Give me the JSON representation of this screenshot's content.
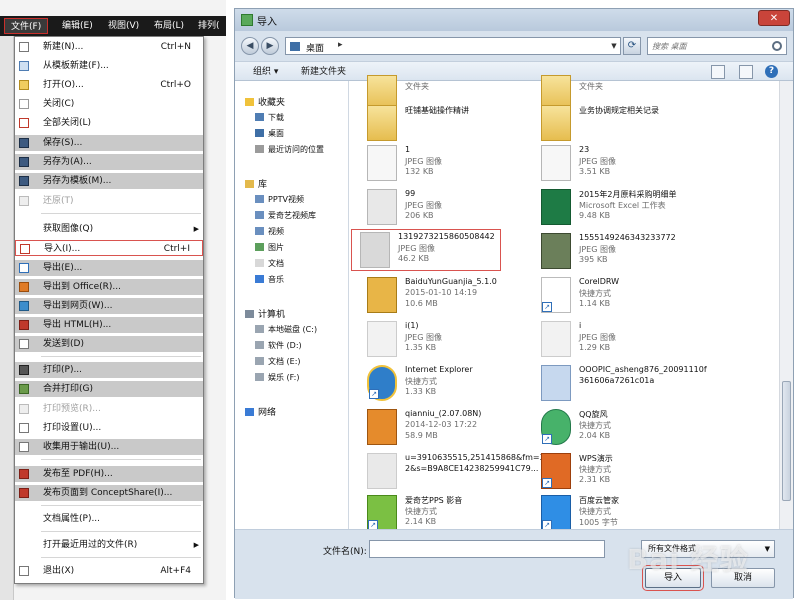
{
  "menubar": {
    "items": [
      {
        "label": "文件(F)"
      },
      {
        "label": "编辑(E)"
      },
      {
        "label": "视图(V)"
      },
      {
        "label": "布局(L)"
      },
      {
        "label": "排列("
      }
    ]
  },
  "file_menu": {
    "items": [
      {
        "label": "新建(N)...",
        "shortcut": "Ctrl+N",
        "shaded": false,
        "disabled": false
      },
      {
        "label": "从模板新建(F)...",
        "shortcut": "",
        "shaded": false,
        "disabled": false
      },
      {
        "label": "打开(O)...",
        "shortcut": "Ctrl+O",
        "shaded": false,
        "disabled": false
      },
      {
        "label": "关闭(C)",
        "shortcut": "",
        "shaded": false,
        "disabled": false
      },
      {
        "label": "全部关闭(L)",
        "shortcut": "",
        "shaded": false,
        "disabled": false
      },
      {
        "label": "保存(S)...",
        "shortcut": "",
        "shaded": true,
        "disabled": false
      },
      {
        "label": "另存为(A)...",
        "shortcut": "",
        "shaded": true,
        "disabled": false
      },
      {
        "label": "另存为模板(M)...",
        "shortcut": "",
        "shaded": true,
        "disabled": false
      },
      {
        "label": "还原(T)",
        "shortcut": "",
        "shaded": false,
        "disabled": true
      },
      {
        "label": "获取图像(Q)",
        "shortcut": "",
        "shaded": false,
        "disabled": false,
        "submenu": true
      },
      {
        "label": "导入(I)...",
        "shortcut": "Ctrl+I",
        "shaded": false,
        "disabled": false,
        "highlight": true
      },
      {
        "label": "导出(E)...",
        "shortcut": "",
        "shaded": true,
        "disabled": false
      },
      {
        "label": "导出到 Office(R)...",
        "shortcut": "",
        "shaded": true,
        "disabled": false
      },
      {
        "label": "导出到网页(W)...",
        "shortcut": "",
        "shaded": true,
        "disabled": false
      },
      {
        "label": "导出 HTML(H)...",
        "shortcut": "",
        "shaded": true,
        "disabled": false
      },
      {
        "label": "发送到(D)",
        "shortcut": "",
        "shaded": true,
        "disabled": false
      },
      {
        "label": "打印(P)...",
        "shortcut": "",
        "shaded": true,
        "disabled": false
      },
      {
        "label": "合并打印(G)",
        "shortcut": "",
        "shaded": true,
        "disabled": false
      },
      {
        "label": "打印预览(R)...",
        "shortcut": "",
        "shaded": false,
        "disabled": true
      },
      {
        "label": "打印设置(U)...",
        "shortcut": "",
        "shaded": false,
        "disabled": false
      },
      {
        "label": "收集用于输出(U)...",
        "shortcut": "",
        "shaded": true,
        "disabled": false
      },
      {
        "label": "发布至 PDF(H)...",
        "shortcut": "",
        "shaded": true,
        "disabled": false
      },
      {
        "label": "发布页面到 ConceptShare(I)...",
        "shortcut": "",
        "shaded": true,
        "disabled": false
      },
      {
        "label": "文档属性(P)...",
        "shortcut": "",
        "shaded": false,
        "disabled": false
      },
      {
        "label": "打开最近用过的文件(R)",
        "shortcut": "",
        "shaded": false,
        "disabled": false,
        "submenu": true
      },
      {
        "label": "退出(X)",
        "shortcut": "Alt+F4",
        "shaded": false,
        "disabled": false
      }
    ]
  },
  "dialog": {
    "title": "导入",
    "close_label": "✕",
    "address": {
      "location": "桌面",
      "separator": "▸"
    },
    "search_placeholder": "搜索 桌面",
    "toolbar": {
      "organize": "组织 ▾",
      "new_folder": "新建文件夹"
    },
    "nav": {
      "favorites_label": "收藏夹",
      "favorites": [
        "下载",
        "桌面",
        "最近访问的位置"
      ],
      "libraries_label": "库",
      "libraries": [
        "PPTV视频",
        "爱奇艺视频库",
        "视频",
        "图片",
        "文档",
        "音乐"
      ],
      "computer_label": "计算机",
      "drives": [
        "本地磁盘 (C:)",
        "软件 (D:)",
        "文档 (E:)",
        "娱乐 (F:)"
      ],
      "network_label": "网络"
    },
    "files": [
      {
        "name": "",
        "kind": "文件夹",
        "meta": "",
        "icon": "folder"
      },
      {
        "name": "",
        "kind": "文件夹",
        "meta": "",
        "icon": "folder"
      },
      {
        "name": "旺铺基础操作精讲",
        "kind": "",
        "meta": "",
        "icon": "folder"
      },
      {
        "name": "业务协调规定相关记录",
        "kind": "",
        "meta": "",
        "icon": "folder"
      },
      {
        "name": "1",
        "kind": "JPEG 图像",
        "meta": "132 KB",
        "icon": "jpeg"
      },
      {
        "name": "23",
        "kind": "JPEG 图像",
        "meta": "3.51 KB",
        "icon": "jpeg"
      },
      {
        "name": "99",
        "kind": "JPEG 图像",
        "meta": "206 KB",
        "icon": "jpeg"
      },
      {
        "name": "2015年2月原料采购明细单",
        "kind": "Microsoft Excel 工作表",
        "meta": "9.48 KB",
        "icon": "excel"
      },
      {
        "name": "1319273215860508442",
        "kind": "JPEG 图像",
        "meta": "46.2 KB",
        "icon": "jpeg",
        "selected": true
      },
      {
        "name": "1555149246343233772",
        "kind": "JPEG 图像",
        "meta": "395 KB",
        "icon": "photo"
      },
      {
        "name": "BaiduYunGuanjia_5.1.0",
        "kind": "2015-01-10 14:19",
        "meta": "10.6 MB",
        "icon": "baidu"
      },
      {
        "name": "CorelDRW",
        "kind": "快捷方式",
        "meta": "1.14 KB",
        "icon": "shortcut-blank"
      },
      {
        "name": "i(1)",
        "kind": "JPEG 图像",
        "meta": "1.35 KB",
        "icon": "portrait"
      },
      {
        "name": "i",
        "kind": "JPEG 图像",
        "meta": "1.29 KB",
        "icon": "portrait"
      },
      {
        "name": "Internet Explorer",
        "kind": "快捷方式",
        "meta": "1.33 KB",
        "icon": "ie"
      },
      {
        "name": "OOOPIC_asheng876_20091110f",
        "kind": "361606a7261c01a",
        "meta": "",
        "icon": "ooopic"
      },
      {
        "name": "qianniu_(2.07.08N)",
        "kind": "2014-12-03 17:22",
        "meta": "58.9 MB",
        "icon": "qianniu"
      },
      {
        "name": "QQ旋风",
        "kind": "快捷方式",
        "meta": "2.04 KB",
        "icon": "qqxf"
      },
      {
        "name": "u=3910635515,251415868&fm=3",
        "kind": "2&s=B9A8CE14238259941C79...",
        "meta": "",
        "icon": "portrait"
      },
      {
        "name": "WPS演示",
        "kind": "快捷方式",
        "meta": "2.31 KB",
        "icon": "wps"
      },
      {
        "name": "爱奇艺PPS 影音",
        "kind": "快捷方式",
        "meta": "2.14 KB",
        "icon": "iqiyi"
      },
      {
        "name": "百度云管家",
        "kind": "快捷方式",
        "meta": "1005 字节",
        "icon": "baiduyun"
      }
    ],
    "footer": {
      "filename_label": "文件名(N):",
      "filename_value": "",
      "filter_value": "所有文件格式",
      "import_label": "导入",
      "cancel_label": "取消",
      "watermark": "Bai 经验"
    }
  }
}
